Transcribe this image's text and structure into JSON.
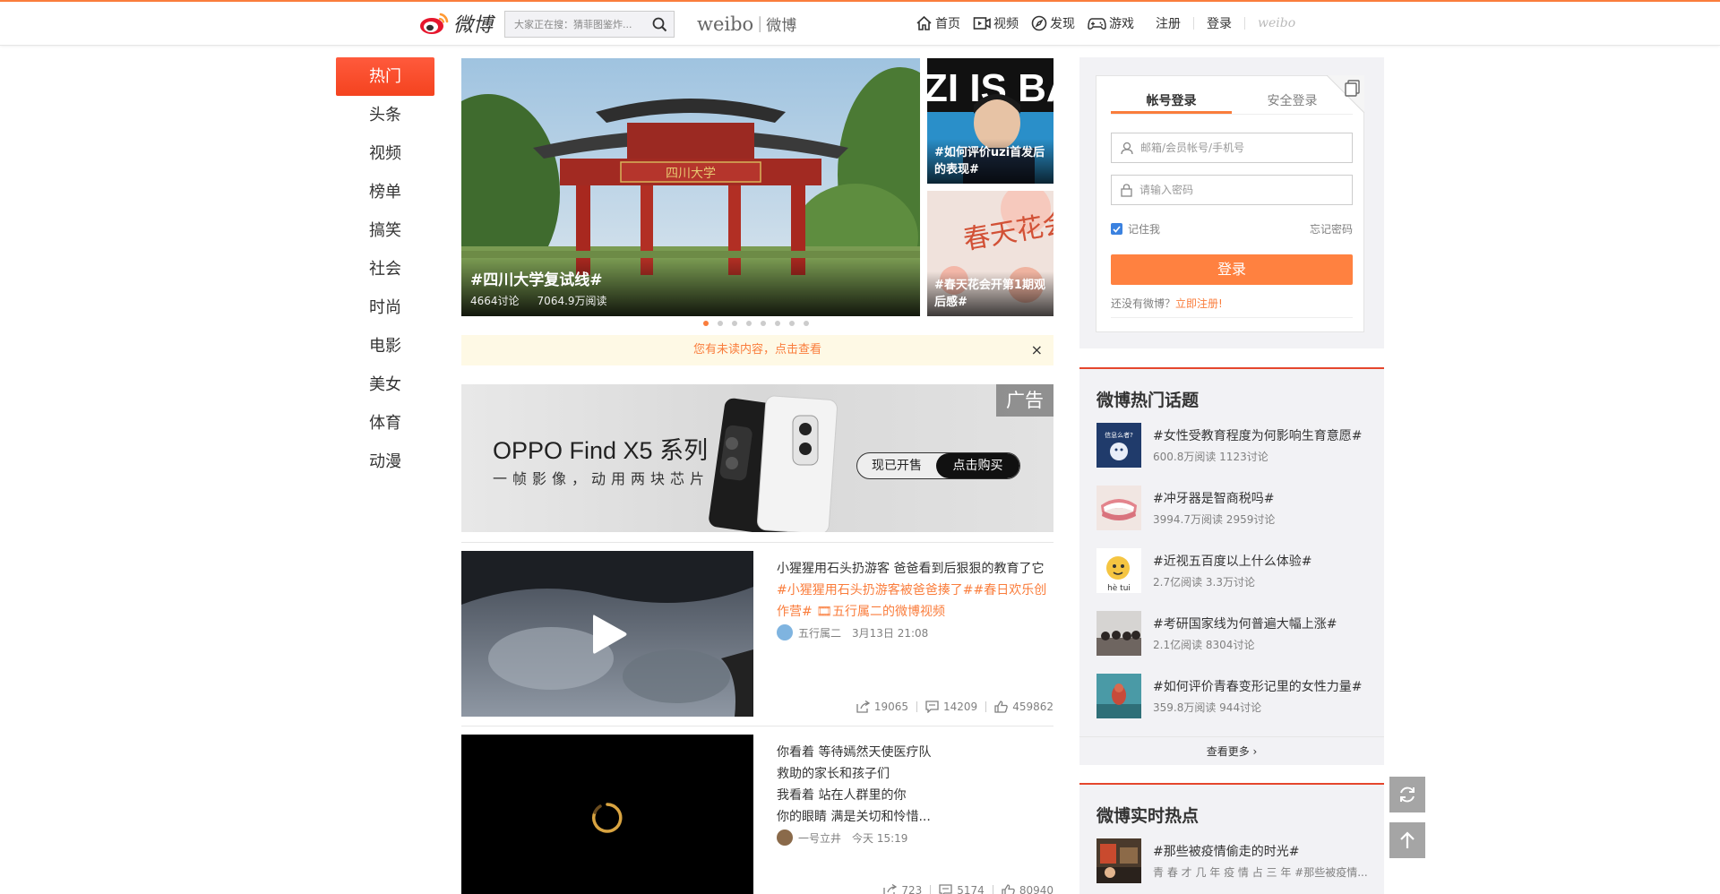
{
  "header": {
    "logo_text": "微博",
    "search_placeholder": "大家正在搜：猜菲图鉴炸...",
    "weibo_en": "weibo",
    "weibo_cn": "微博",
    "nav": {
      "home": "首页",
      "video": "视频",
      "discover": "发现",
      "game": "游戏",
      "register": "注册",
      "login": "登录",
      "small_logo": "weibo"
    }
  },
  "leftnav": [
    "热门",
    "头条",
    "视频",
    "榜单",
    "搞笑",
    "社会",
    "时尚",
    "电影",
    "美女",
    "体育",
    "动漫"
  ],
  "hero": {
    "title": "#四川大学复试线#",
    "discussions": "4664讨论",
    "reads": "7064.9万阅读",
    "arch_plaque": "四川大学",
    "slide_count": 8,
    "active_slide": 0
  },
  "side_thumbs": [
    {
      "caption": "#如何评价uzi首发后的表现#",
      "banner_text": "ZI IS BAC"
    },
    {
      "caption": "#春天花会开第1期观后感#",
      "art_text": "春天花会开"
    }
  ],
  "notice": {
    "text": "您有未读内容，点击查看",
    "close": "×"
  },
  "ad": {
    "badge": "广告",
    "title": "OPPO Find X5 系列",
    "subtitle": "一帧影像，动用两块芯片",
    "btn_onsale": "现已开售",
    "btn_buy": "点击购买"
  },
  "feeds": [
    {
      "text": "小猩猩用石头扔游客 爸爸看到后狠狠的教育了它",
      "tags": "#小猩猩用石头扔游客被爸爸揍了##春日欢乐创作营# 🎞五行属二的微博视频",
      "author": "五行属二",
      "time": "3月13日 21:08",
      "shares": "19065",
      "comments": "14209",
      "likes": "459862"
    },
    {
      "text_lines": [
        "你看着 等待嫣然天使医疗队",
        "救助的家长和孩子们",
        "我看着 站在人群里的你",
        "你的眼睛 满是关切和怜惜..."
      ],
      "author": "一号立井",
      "time": "今天 15:19",
      "shares": "723",
      "comments": "5174",
      "likes": "80940"
    }
  ],
  "login": {
    "tab_account": "帐号登录",
    "tab_secure": "安全登录",
    "username_placeholder": "邮箱/会员帐号/手机号",
    "password_placeholder": "请输入密码",
    "remember": "记住我",
    "forgot": "忘记密码",
    "button": "登录",
    "no_account": "还没有微博？",
    "register_now": "立即注册!"
  },
  "hot_topics": {
    "title": "微博热门话题",
    "items": [
      {
        "title": "#女性受教育程度为何影响生育意愿#",
        "meta": "600.8万阅读 1123讨论",
        "img_text": "信息么者?"
      },
      {
        "title": "#冲牙器是智商税吗#",
        "meta": "3994.7万阅读 2959讨论"
      },
      {
        "title": "#近视五百度以上什么体验#",
        "meta": "2.7亿阅读 3.3万讨论",
        "img_text": "hè tui"
      },
      {
        "title": "#考研国家线为何普遍大幅上涨#",
        "meta": "2.1亿阅读 8304讨论"
      },
      {
        "title": "#如何评价青春变形记里的女性力量#",
        "meta": "359.8万阅读 944讨论"
      }
    ],
    "see_more": "查看更多 ›"
  },
  "realtime": {
    "title": "微博实时热点",
    "items": [
      {
        "title": "#那些被疫情偷走的时光#",
        "meta": "青 春 才 几 年 疫 情 占 三 年 #那些被疫情..."
      }
    ]
  },
  "colors": {
    "accent": "#fa7d3c",
    "active_nav": "#f4431f",
    "login_button": "#ff8140",
    "panel_bg": "#f2f2f5"
  }
}
